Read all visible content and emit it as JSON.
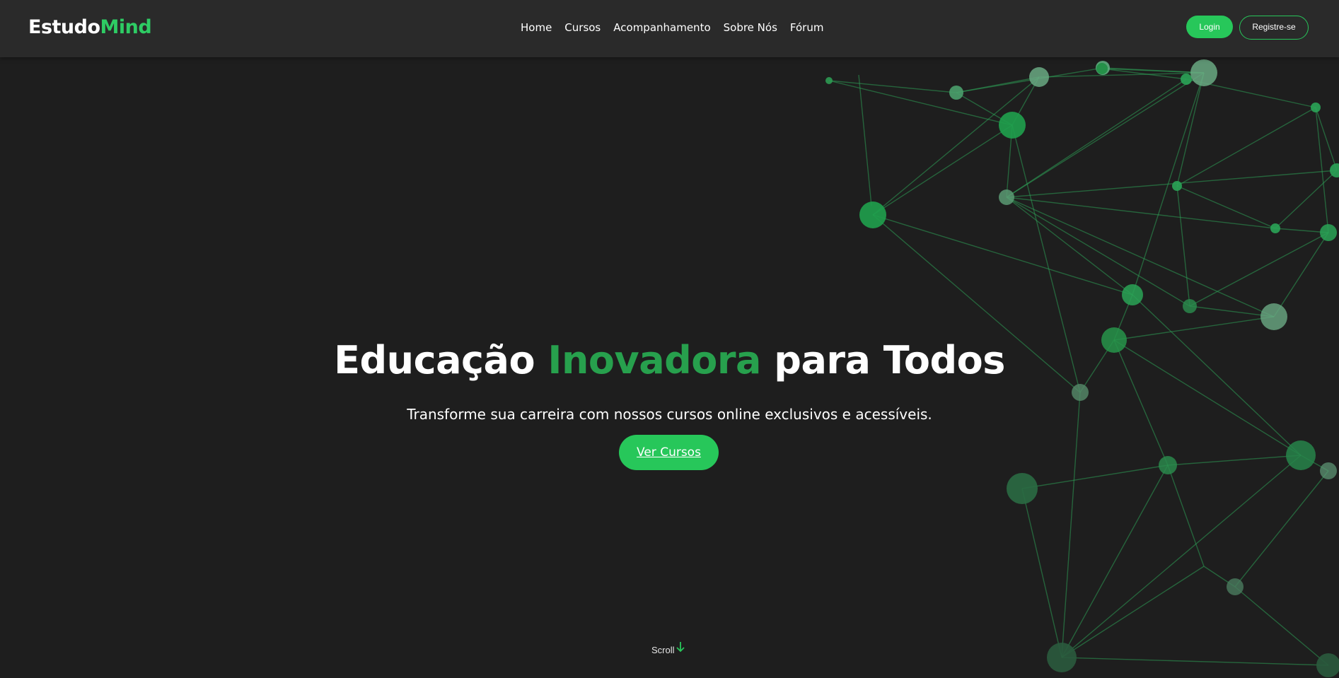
{
  "nav": {
    "logo_part1": "Estudo",
    "logo_part2": "Mind",
    "links": [
      "Home",
      "Cursos",
      "Acompanhamento",
      "Sobre Nós",
      "Fórum"
    ],
    "login_label": "Login",
    "register_label": "Registre-se"
  },
  "hero": {
    "title_start": "Educação",
    "title_accent": "Inovadora",
    "title_end": "para Todos",
    "subtitle": "Transforme sua carreira com nossos cursos online exclusivos e acessíveis.",
    "cta_label": "Ver Cursos",
    "scroll_label": "Scroll"
  },
  "colors": {
    "background": "#1e1e1e",
    "navbar": "#2a2a2a",
    "accent": "#27c75a",
    "accent_dark": "#27a04d"
  },
  "icons": {
    "scroll": "arrow-down-icon",
    "background": "network-graph-decoration"
  }
}
